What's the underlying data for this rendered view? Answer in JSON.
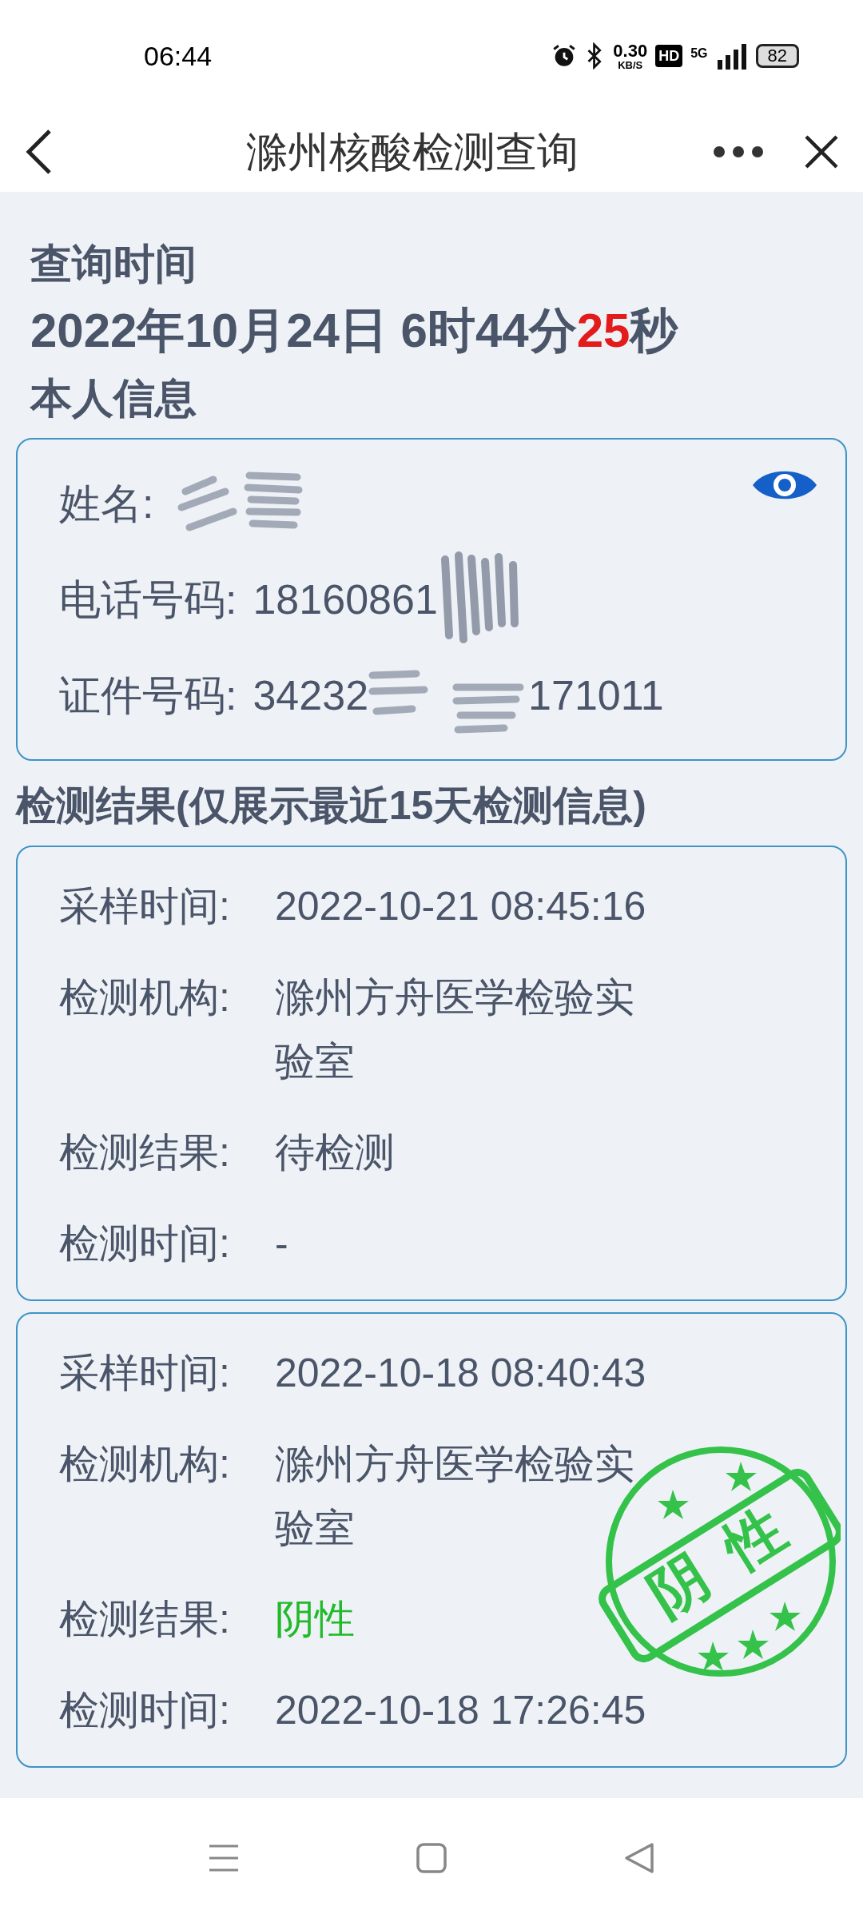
{
  "status_bar": {
    "time": "06:44",
    "speed": "0.30",
    "speed_unit": "KB/S",
    "hd": "HD",
    "network": "5G",
    "battery": "82"
  },
  "header": {
    "title": "滁州核酸检测查询"
  },
  "query": {
    "label": "查询时间",
    "date_parts": [
      {
        "text": "2022年10月24日 6时44分",
        "highlight": false
      },
      {
        "text": "25",
        "highlight": true
      },
      {
        "text": "秒",
        "highlight": false
      }
    ]
  },
  "personal": {
    "title": "本人信息",
    "fields": [
      {
        "kind": "name",
        "label": "姓名:"
      },
      {
        "kind": "phone",
        "label": "电话号码:",
        "value": "18160861"
      },
      {
        "kind": "id",
        "label": "证件号码:",
        "value": "34232",
        "value_end": "171011"
      }
    ]
  },
  "results": {
    "title": "检测结果(仅展示最近15天检测信息)",
    "records": [
      {
        "fields": [
          {
            "label": "采样时间:",
            "value": "2022-10-21 08:45:16"
          },
          {
            "label": "检测机构:",
            "value": "滁州方舟医学检验实验室"
          },
          {
            "label": "检测结果:",
            "value": "待检测",
            "color": "#4b5569"
          },
          {
            "label": "检测时间:",
            "value": "-"
          }
        ]
      },
      {
        "stamp": [
          "阴",
          "性"
        ],
        "fields": [
          {
            "label": "采样时间:",
            "value": "2022-10-18 08:40:43"
          },
          {
            "label": "检测机构:",
            "value": "滁州方舟医学检验实验室"
          },
          {
            "label": "检测结果:",
            "value": "阴性",
            "color": "#22b92a"
          },
          {
            "label": "检测时间:",
            "value": "2022-10-18 17:26:45"
          }
        ]
      }
    ]
  }
}
